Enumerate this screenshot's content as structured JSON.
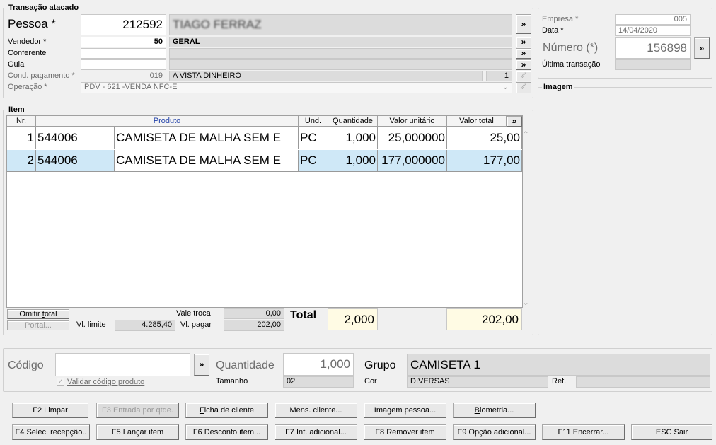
{
  "transacao": {
    "title": "Transação atacado",
    "pessoa_label": "Pessoa *",
    "pessoa_code": "212592",
    "pessoa_name": "TIAGO FERRAZ",
    "vendedor_label": "Vendedor *",
    "vendedor_code": "50",
    "vendedor_name": "GERAL",
    "conferente_label": "Conferente",
    "guia_label": "Guia",
    "cond_label": "Cond. pagamento *",
    "cond_code": "019",
    "cond_name": "A VISTA DINHEIRO",
    "cond_count": "1",
    "operacao_label": "Operação *",
    "operacao_value": "PDV - 621 -VENDA NFC-E",
    "lookup_glyph": "»"
  },
  "empresa": {
    "empresa_label": "Empresa *",
    "empresa_value": "005",
    "data_label": "Data *",
    "data_value": "14/04/2020",
    "numero_label": "Número (*)",
    "numero_value": "156898",
    "ultima_label": "Última transação"
  },
  "imagem": {
    "title": "Imagem"
  },
  "item": {
    "title": "Item",
    "columns": [
      "Nr.",
      "Produto",
      "Und.",
      "Quantidade",
      "Valor unitário",
      "Valor total"
    ],
    "rows": [
      {
        "nr": "1",
        "code": "544006",
        "desc": "CAMISETA DE MALHA SEM E",
        "und": "PC",
        "qtd": "1,000",
        "unit": "25,000000",
        "total": "25,00"
      },
      {
        "nr": "2",
        "code": "544006",
        "desc": "CAMISETA DE MALHA SEM E",
        "und": "PC",
        "qtd": "1,000",
        "unit": "177,000000",
        "total": "177,00"
      }
    ],
    "omitir_label": "Omitir total",
    "portal_label": "Portal...",
    "vl_limite_label": "Vl. limite",
    "vl_limite_value": "4.285,40",
    "vale_troca_label": "Vale troca",
    "vale_troca_value": "0,00",
    "vl_pagar_label": "Vl. pagar",
    "vl_pagar_value": "202,00",
    "total_label": "Total",
    "total_qtd": "2,000",
    "total_valor": "202,00"
  },
  "entrada": {
    "codigo_label": "Código",
    "codigo_value": "",
    "validar_label": "Validar código produto",
    "quantidade_label": "Quantidade",
    "quantidade_value": "1,000",
    "tamanho_label": "Tamanho",
    "tamanho_value": "02",
    "grupo_label": "Grupo",
    "grupo_value": "CAMISETA 1",
    "cor_label": "Cor",
    "cor_value": "DIVERSAS",
    "ref_label": "Ref.",
    "ref_value": ""
  },
  "buttons_row1": [
    "F2 Limpar",
    "F3 Entrada por qtde.",
    "Ficha de cliente",
    "Mens. cliente...",
    "Imagem pessoa...",
    "Biometria..."
  ],
  "buttons_row2": [
    "F4 Selec. recepção..",
    "F5 Lançar item",
    "F6 Desconto item...",
    "F7 Inf. adicional...",
    "F8 Remover item",
    "F9 Opção adicional...",
    "F11 Encerrar...",
    "ESC Sair"
  ],
  "colors": {
    "selected_row": "#cfe8f7",
    "total_bg": "#fffbe4",
    "window_bg": "#f0f0f0"
  }
}
